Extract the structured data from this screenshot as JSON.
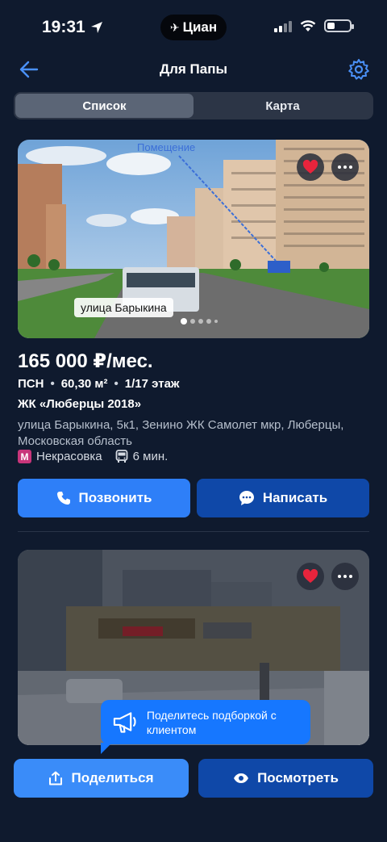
{
  "status_bar": {
    "time": "19:31",
    "carrier_label": "Циан"
  },
  "nav": {
    "title": "Для Папы"
  },
  "segmented": {
    "list_label": "Список",
    "map_label": "Карта",
    "selected": "list"
  },
  "listing": {
    "photo_caption": "улица Барыкина",
    "photo_annotation": "Помещение",
    "price": "165 000 ₽/мес.",
    "type": "ПСН",
    "area": "60,30 м²",
    "floor": "1/17 этаж",
    "complex": "ЖК «Люберцы 2018»",
    "address": "улица Барыкина, 5к1, Зенино ЖК Самолет мкр, Люберцы, Московская область",
    "metro_station": "Некрасовка",
    "commute": "6 мин.",
    "call_label": "Позвонить",
    "write_label": "Написать",
    "favorited": true
  },
  "second_listing": {
    "favorited": true
  },
  "tooltip": {
    "text": "Поделитесь подборкой с клиентом"
  },
  "bottom_actions": {
    "share_label": "Поделиться",
    "view_label": "Посмотреть"
  },
  "colors": {
    "background": "#0f1a2e",
    "primary_blue": "#2e7ff8",
    "dark_blue": "#0f48a8",
    "favorite_red": "#e8243c",
    "metro_magenta": "#c8357a"
  },
  "icons": {
    "back": "arrow-left-icon",
    "settings": "gear-icon",
    "favorite": "heart-icon",
    "more": "more-dots-icon",
    "call": "phone-icon",
    "write": "chat-bubble-icon",
    "share": "share-icon",
    "view": "eye-icon"
  }
}
